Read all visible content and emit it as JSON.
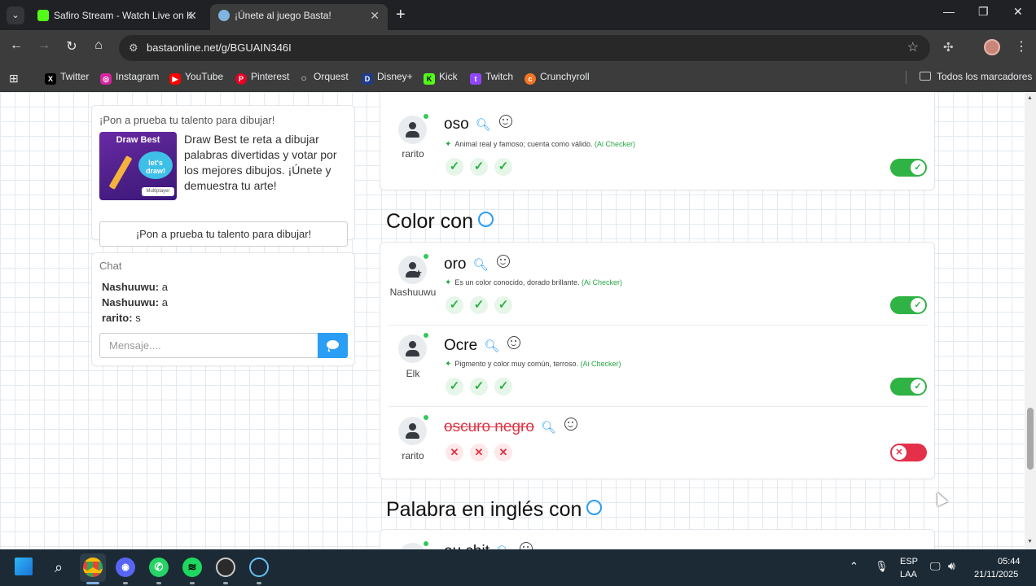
{
  "browser": {
    "tabs": [
      {
        "title": "Safiro Stream - Watch Live on K",
        "active": false,
        "favicon_color": "#53fc18"
      },
      {
        "title": "¡Únete al juego Basta!",
        "active": true,
        "favicon_color": "#7fb3e0"
      }
    ],
    "url": "bastaonline.net/g/BGUAIN346I",
    "bookmarks": [
      {
        "label": "Twitter",
        "icon": "x-logo-icon",
        "color": "#000000"
      },
      {
        "label": "Instagram",
        "icon": "instagram-icon",
        "color": "#d6249f"
      },
      {
        "label": "YouTube",
        "icon": "youtube-icon",
        "color": "#ff0000"
      },
      {
        "label": "Pinterest",
        "icon": "pinterest-icon",
        "color": "#e60023"
      },
      {
        "label": "Orquest",
        "icon": "orquest-icon",
        "color": "#9aa0a6"
      },
      {
        "label": "Disney+",
        "icon": "disney-icon",
        "color": "#1f3c88"
      },
      {
        "label": "Kick",
        "icon": "kick-icon",
        "color": "#53fc18"
      },
      {
        "label": "Twitch",
        "icon": "twitch-icon",
        "color": "#9146ff"
      },
      {
        "label": "Crunchyroll",
        "icon": "crunchyroll-icon",
        "color": "#f47521"
      }
    ],
    "all_bookmarks_label": "Todos los marcadores"
  },
  "sidebar": {
    "promo": {
      "title": "¡Pon a prueba tu talento para dibujar!",
      "image_title": "Draw Best",
      "image_cloud": "let's draw!",
      "image_badge": "Multiplayer",
      "description": "Draw Best te reta a dibujar palabras divertidas y votar por los mejores dibujos. ¡Únete y demuestra tu arte!",
      "button": "¡Pon a prueba tu talento para dibujar!"
    },
    "chat": {
      "title": "Chat",
      "messages": [
        {
          "user": "Nashuuwu:",
          "text": "a"
        },
        {
          "user": "Nashuuwu:",
          "text": "a"
        },
        {
          "user": "rarito:",
          "text": "s"
        }
      ],
      "input_placeholder": "Mensaje...."
    }
  },
  "main": {
    "top_answer": {
      "word": "oso",
      "user": "rarito",
      "hint": "Animal real y famoso; cuenta como válido.",
      "ai_label": "(Ai Checker)",
      "votes": [
        "ok",
        "ok",
        "ok"
      ],
      "valid": true
    },
    "section_color": {
      "title": "Color con",
      "answers": [
        {
          "word": "oro",
          "user": "Nashuuwu",
          "hint": "Es un color conocido, dorado brillante.",
          "ai_label": "(Ai Checker)",
          "votes": [
            "ok",
            "ok",
            "ok"
          ],
          "valid": true
        },
        {
          "word": "Ocre",
          "user": "Elk",
          "hint": "Pigmento y color muy común, terroso.",
          "ai_label": "(Ai Checker)",
          "votes": [
            "ok",
            "ok",
            "ok"
          ],
          "valid": true
        },
        {
          "word": "oscuro negro",
          "user": "rarito",
          "hint": "",
          "votes": [
            "no",
            "no",
            "no"
          ],
          "valid": false
        }
      ]
    },
    "section_english": {
      "title": "Palabra en inglés con",
      "partial_word": "ou chit"
    }
  },
  "taskbar": {
    "lang_top": "ESP",
    "lang_bottom": "LAA",
    "time": "05:44",
    "date": "21/11/2025"
  }
}
